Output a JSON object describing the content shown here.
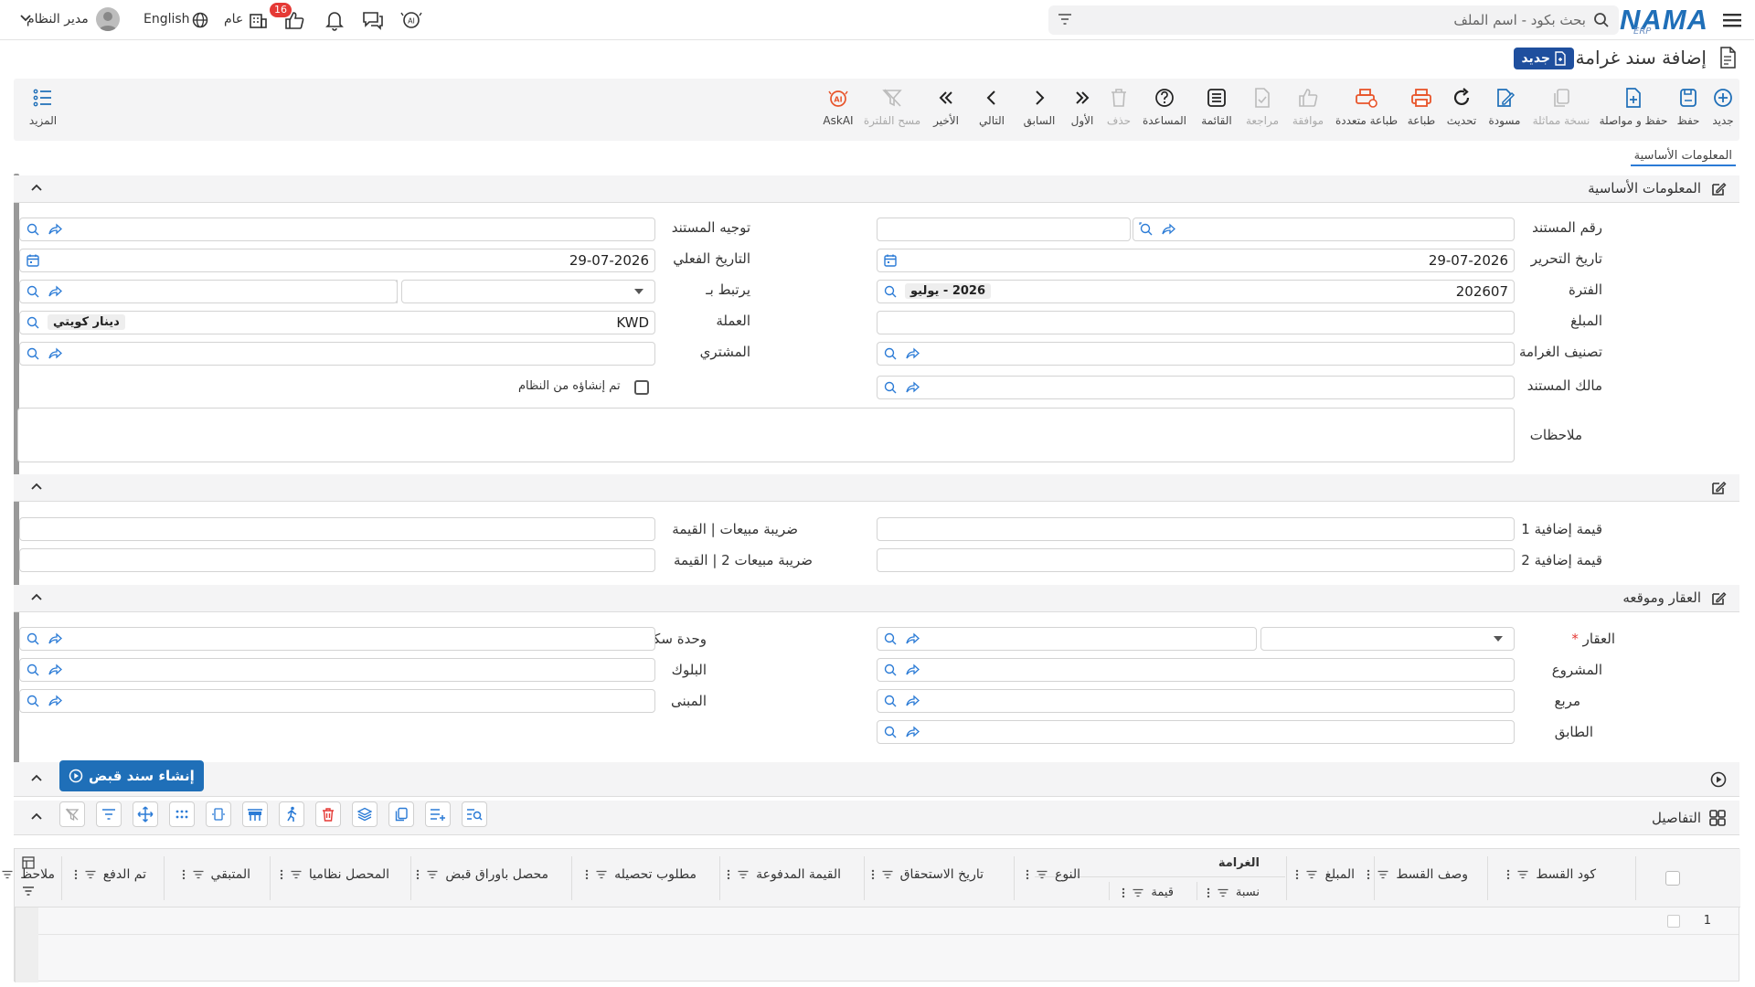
{
  "topbar": {
    "logo": "NAMA",
    "logo_sub": "ERP",
    "search_placeholder": "بحث بكود - اسم الملف",
    "notification_count": "16",
    "scope": "عام",
    "language": "English",
    "user": "مدير النظام"
  },
  "page": {
    "title": "إضافة سند غرامة",
    "badge": "جديد"
  },
  "toolbar": {
    "new": "جديد",
    "save": "حفظ",
    "save_continue": "حفظ و مواصلة",
    "duplicate": "نسخة مماثلة",
    "draft": "مسودة",
    "refresh": "تحديث",
    "print": "طباعة",
    "multi_print": "طباعة متعددة",
    "approve": "موافقة",
    "review": "مراجعة",
    "list": "القائمة",
    "help": "المساعدة",
    "delete": "حذف",
    "first": "الأول",
    "previous": "السابق",
    "next": "التالي",
    "last": "الأخير",
    "clear_filter": "مسح الفلترة",
    "askai": "AskAI",
    "more": "المزيد"
  },
  "tabs": [
    "المعلومات الأساسية"
  ],
  "basic": {
    "section_title": "المعلومات الأساسية",
    "doc_number": "رقم المستند",
    "doc_direction": "توجيه المستند",
    "issue_date": "تاريخ التحرير",
    "issue_date_value": "29-07-2026",
    "actual_date": "التاريخ الفعلي",
    "actual_date_value": "29-07-2026",
    "period": "الفترة",
    "period_value": "202607",
    "period_tag": "2026 - يوليو",
    "linked_to": "يرتبط بـ",
    "amount": "المبلغ",
    "currency": "العملة",
    "currency_value": "KWD",
    "currency_tag": "دينار كويتي",
    "penalty_class": "تصنيف الغرامة",
    "buyer": "المشتري",
    "doc_owner": "مالك المستند",
    "system_created": "تم إنشاؤه من النظام",
    "notes": "ملاحظات"
  },
  "extra": {
    "value1": "قيمة إضافية 1",
    "value2": "قيمة إضافية 2",
    "tax1": "ضريبة مبيعات | القيمة",
    "tax2": "ضريبة مبيعات 2 | القيمة"
  },
  "property": {
    "section_title": "العقار وموقعه",
    "property": "العقار",
    "unit": "وحدة سكنية",
    "project": "المشروع",
    "block": "البلوك",
    "square": "مربع",
    "building": "المبنى",
    "floor": "الطابق"
  },
  "actions": {
    "create_receipt": "إنشاء سند قبض"
  },
  "details": {
    "section_title": "التفاصيل",
    "group_header": "الغرامة",
    "columns": {
      "code": "كود القسط",
      "desc": "وصف القسط",
      "amount": "المبلغ",
      "ratio": "نسبة",
      "value": "قيمة",
      "type": "النوع",
      "due_date": "تاريخ الاستحقاق",
      "paid": "القيمة المدفوعة",
      "required": "مطلوب تحصيله",
      "by_notes": "محصل باوراق قبض",
      "system_collected": "المحصل نظاميا",
      "remaining": "المتبقي",
      "is_paid": "تم الدفع",
      "note": "ملاحظ"
    },
    "row_number": "1"
  }
}
